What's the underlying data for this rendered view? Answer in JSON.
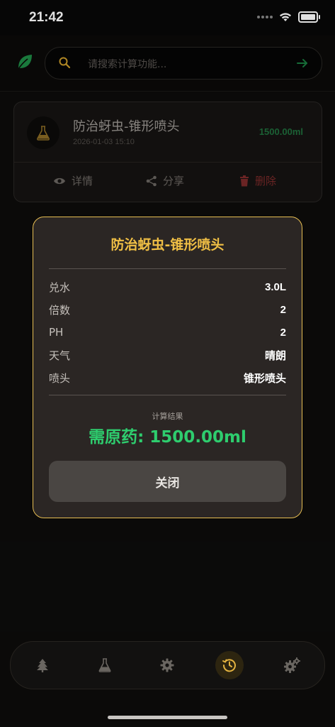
{
  "status_bar": {
    "time": "21:42"
  },
  "search": {
    "placeholder": "请搜索计算功能..."
  },
  "record": {
    "title": "防治蚜虫-锥形喷头",
    "timestamp": "2026-01-03 15:10",
    "amount": "1500.00ml",
    "actions": {
      "details": "详情",
      "share": "分享",
      "delete": "删除"
    }
  },
  "dialog": {
    "title": "防治蚜虫-锥形喷头",
    "rows": [
      {
        "label": "兑水",
        "value": "3.0L"
      },
      {
        "label": "倍数",
        "value": "2"
      },
      {
        "label": "PH",
        "value": "2"
      },
      {
        "label": "天气",
        "value": "晴朗"
      },
      {
        "label": "喷头",
        "value": "锥形喷头"
      }
    ],
    "result_label": "计算结果",
    "result_value": "需原药: 1500.00ml",
    "close_label": "关闭"
  },
  "tabbar": {
    "items": [
      "tree-icon",
      "flask-icon",
      "gear-icon",
      "history-icon",
      "settings-gears-icon"
    ],
    "active_index": 3
  },
  "colors": {
    "accent": "#f0bf45",
    "result_green": "#2ecd6e",
    "delete_red": "#c8403a"
  }
}
